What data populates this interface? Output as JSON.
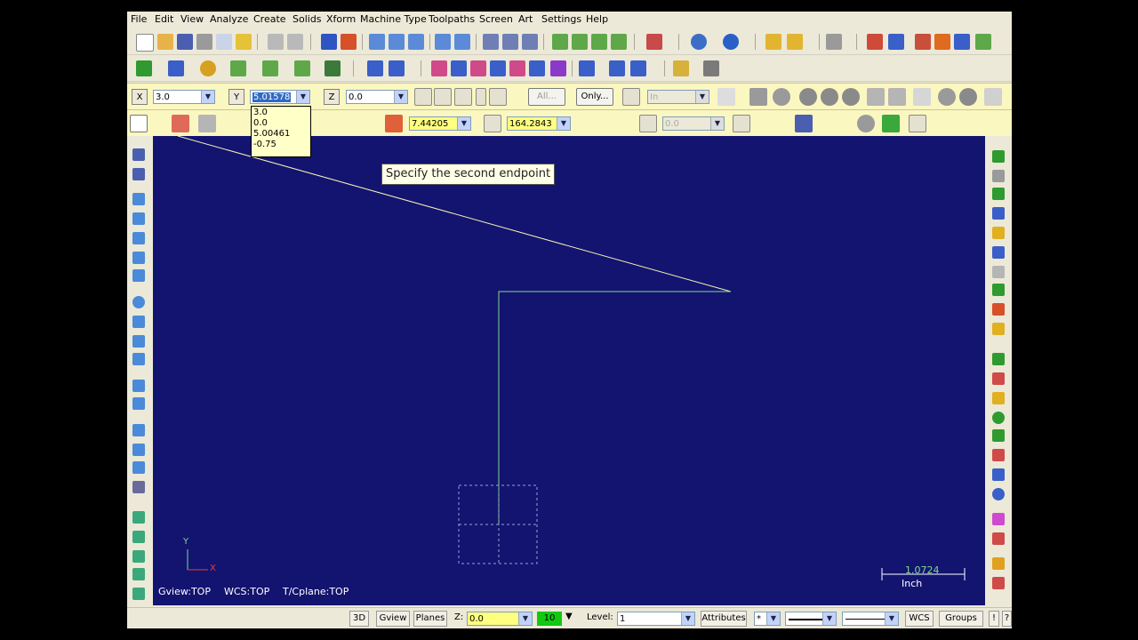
{
  "menu": [
    "File",
    "Edit",
    "View",
    "Analyze",
    "Create",
    "Solids",
    "Xform",
    "Machine Type",
    "Toolpaths",
    "Screen",
    "Art",
    "Settings",
    "Help"
  ],
  "autocursor": {
    "x_label": "X",
    "x_value": "3.0",
    "y_label": "Y",
    "y_value": "5.01578",
    "z_label": "Z",
    "z_value": "0.0",
    "y_history": [
      "3.0",
      "0.0",
      "5.00461",
      "-0.75"
    ],
    "all_label": "All...",
    "only_label": "Only...",
    "units_value": "In"
  },
  "line_ribbon": {
    "length_value": "7.44205",
    "angle_value": "164.2843",
    "vertical_value": "0.0"
  },
  "prompt": "Specify the second endpoint",
  "view_info": {
    "gview": "Gview:TOP",
    "wcs": "WCS:TOP",
    "cplane": "T/Cplane:TOP",
    "axis_y": "Y",
    "axis_x": "X",
    "scale_value": "1.0724",
    "scale_unit": "Inch"
  },
  "statusbar": {
    "btn_3d": "3D",
    "btn_gview": "Gview",
    "btn_planes": "Planes",
    "z_label": "Z:",
    "z_value": "0.0",
    "color_value": "10",
    "level_label": "Level:",
    "level_value": "1",
    "attributes": "Attributes",
    "point_style": "*",
    "wcs": "WCS",
    "groups": "Groups",
    "help_btn": "!",
    "q_btn": "?"
  },
  "colors": {
    "viewport_bg": "#131370",
    "sketch_line": "#f4f4b0",
    "green_geometry": "#7ddc8c",
    "ribbon_bg": "#fbf7c0"
  }
}
